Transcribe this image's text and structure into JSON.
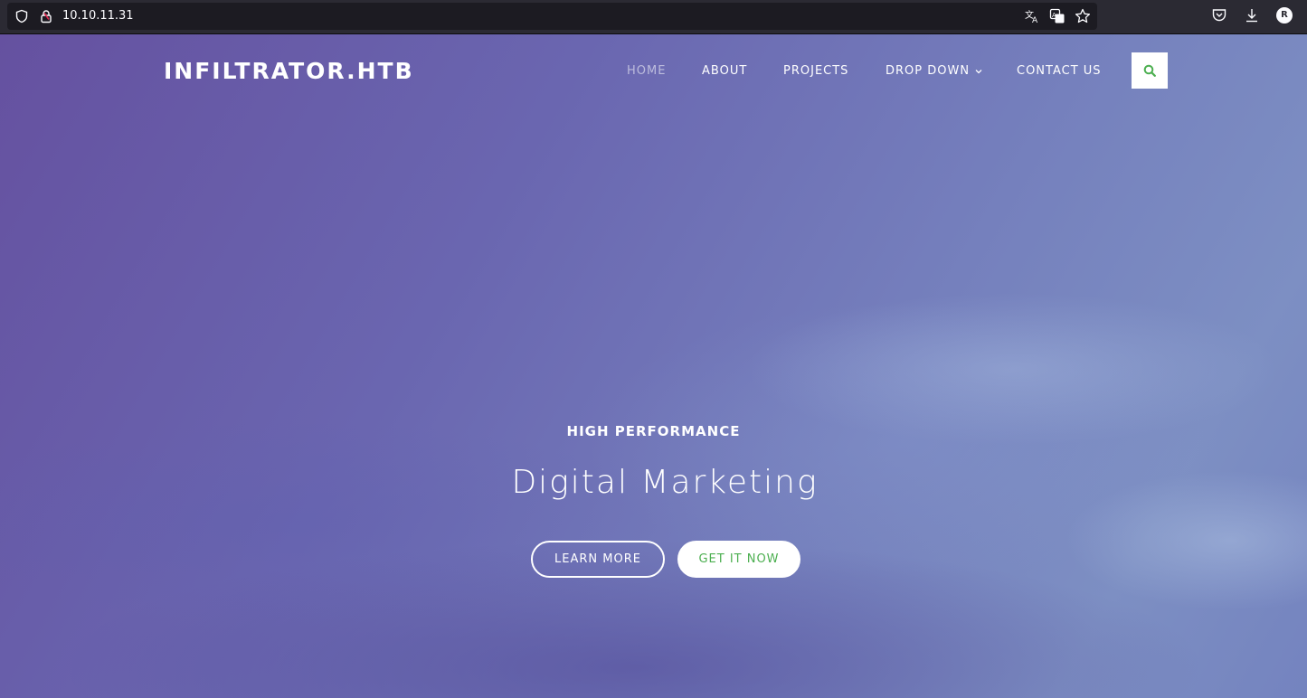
{
  "browser": {
    "url": "10.10.11.31",
    "icons": [
      "shield-icon",
      "lock-warning-icon",
      "translate-icon",
      "reader-icon",
      "bookmark-star-icon",
      "pocket-icon",
      "download-icon",
      "account-icon"
    ],
    "account_initial": "R"
  },
  "site": {
    "logo": "INFILTRATOR.HTB",
    "nav": {
      "home": "HOME",
      "about": "ABOUT",
      "projects": "PROJECTS",
      "dropdown": "DROP DOWN",
      "contact": "CONTACT US"
    },
    "hero": {
      "kicker": "HIGH PERFORMANCE",
      "title": "Digital Marketing",
      "learn_more": "LEARN MORE",
      "get_it_now": "GET IT NOW"
    }
  },
  "colors": {
    "accent_green": "#4caf50",
    "hero_purple": "#6551a0",
    "hero_blue": "#7d8fc3"
  }
}
